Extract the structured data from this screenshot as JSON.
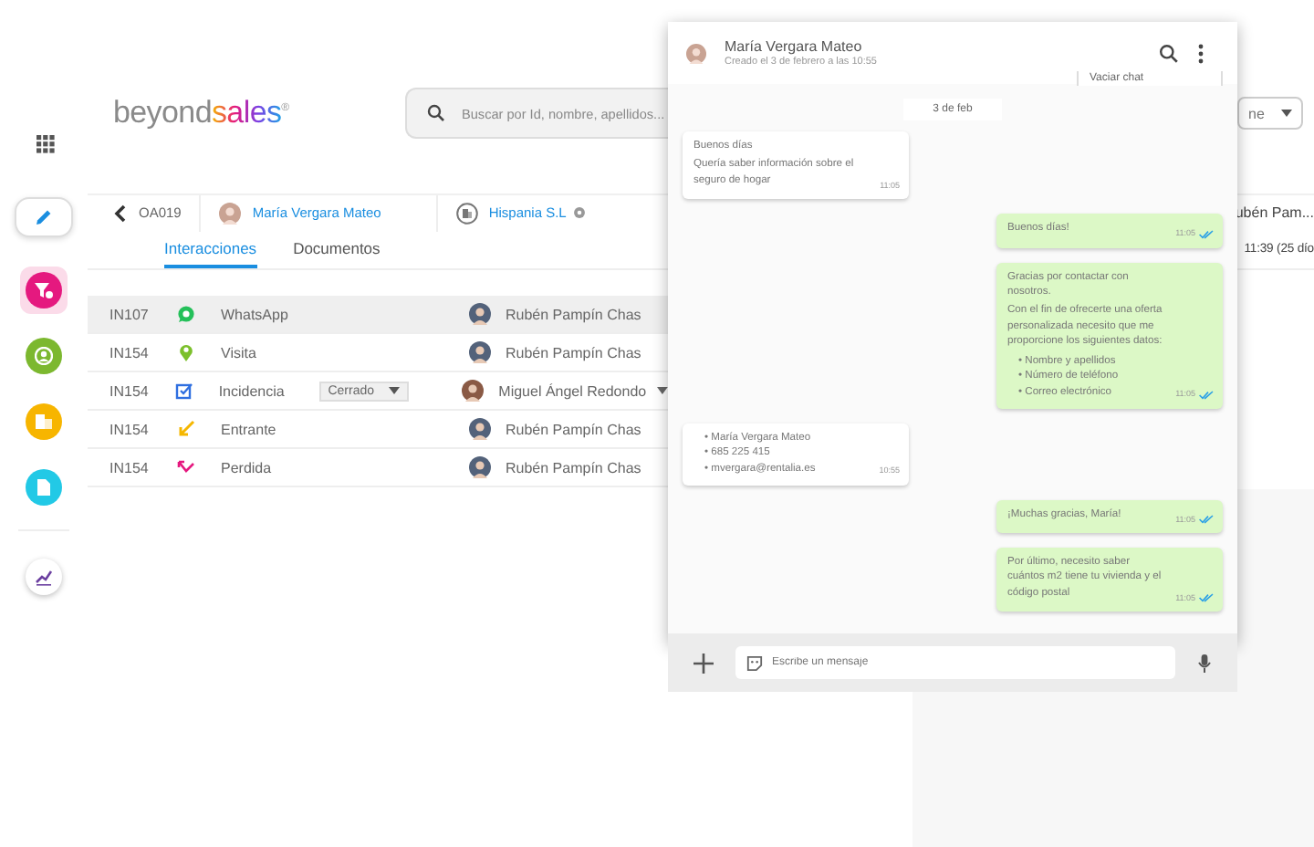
{
  "sidebar": {
    "items": [
      {
        "kind": "filter",
        "selected": true
      },
      {
        "kind": "contact",
        "selected": false
      },
      {
        "kind": "company",
        "selected": false
      },
      {
        "kind": "document",
        "selected": false
      },
      {
        "kind": "chart",
        "selected": false
      }
    ]
  },
  "logo": {
    "first": "beyond",
    "second": "sales",
    "mark": "®"
  },
  "search": {
    "placeholder": "Buscar por Id, nombre, apellidos..."
  },
  "breadcrumb": {
    "code": "OA019",
    "contact": "María Vergara Mateo",
    "company": "Hispania S.L"
  },
  "tabs": [
    {
      "label": "Interacciones",
      "selected": true
    },
    {
      "label": "Documentos",
      "selected": false
    }
  ],
  "interactions": [
    {
      "id": "IN107",
      "kind": "whatsapp",
      "type": "WhatsApp",
      "agent": "Rubén Pampín Chas",
      "selected": true
    },
    {
      "id": "IN154",
      "kind": "visit",
      "type": "Visita",
      "agent": "Rubén Pampín Chas",
      "selected": false
    },
    {
      "id": "IN154",
      "kind": "incident",
      "type": "Incidencia",
      "status": "Cerrado",
      "agent": "Miguel Ángel Redondo",
      "selected": false
    },
    {
      "id": "IN154",
      "kind": "incoming",
      "type": "Entrante",
      "agent": "Rubén Pampín Chas",
      "selected": false
    },
    {
      "id": "IN154",
      "kind": "missed",
      "type": "Perdida",
      "agent": "Rubén Pampín Chas",
      "selected": false
    }
  ],
  "background_panel": {
    "filter": "ne",
    "agent": "ubén Pam...",
    "time": "11:39 (25 dío"
  },
  "chat": {
    "name": "María Vergara Mateo",
    "created": "Creado el 3 de febrero a las 10:55",
    "menu": [
      "Vaciar chat"
    ],
    "date": "3 de feb",
    "messages": [
      {
        "kind": "incoming",
        "lines": [
          "Buenos días",
          "Quería saber información sobre el seguro de hogar"
        ],
        "time": "11:05"
      },
      {
        "kind": "outgoing",
        "lines": [
          "Buenos días!"
        ],
        "time": "11:05",
        "read": true
      },
      {
        "kind": "outgoing",
        "lines": [
          "Gracias por contactar con nosotros.",
          "Con el fin de ofrecerte una oferta personalizada necesito que me proporcione los siguientes datos:"
        ],
        "bullets": [
          "• Nombre y apellidos",
          "• Número de teléfono",
          "• Correo electrónico"
        ],
        "time": "11:05",
        "read": true
      },
      {
        "kind": "incoming",
        "bullets": [
          "• María Vergara Mateo",
          "• 685 225 415",
          "• mvergara@rentalia.es"
        ],
        "time": "10:55"
      },
      {
        "kind": "outgoing",
        "lines": [
          "¡Muchas gracias, María!"
        ],
        "time": "11:05",
        "read": true
      },
      {
        "kind": "outgoing",
        "lines": [
          "Por último, necesito saber cuántos m2 tiene tu vivienda y el código postal"
        ],
        "time": "11:05",
        "read": true
      }
    ],
    "input": {
      "placeholder": "Escribe un mensaje"
    }
  }
}
